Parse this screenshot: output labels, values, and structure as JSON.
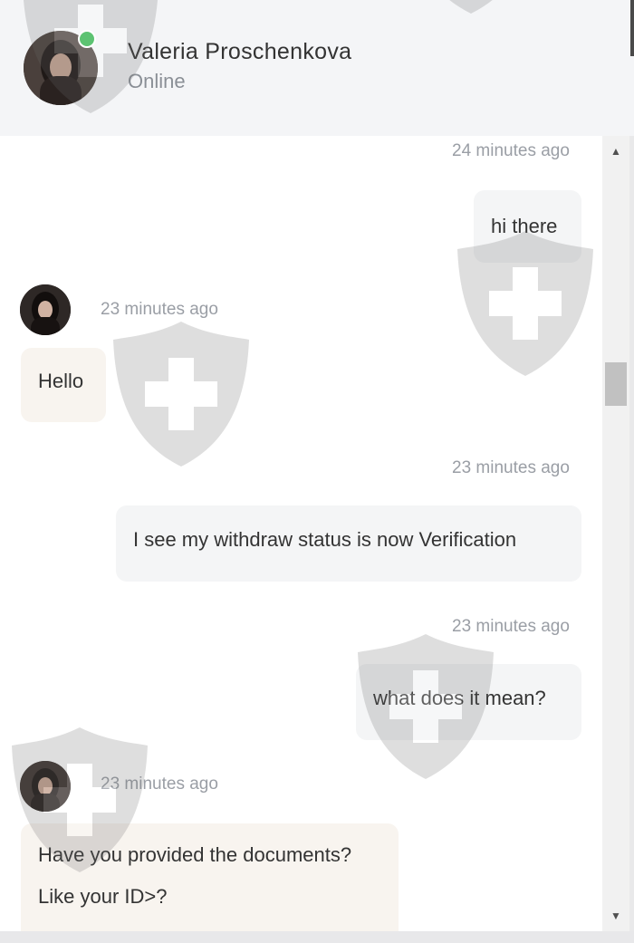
{
  "header": {
    "name": "Valeria Proschenkova",
    "status": "Online"
  },
  "messages": [
    {
      "direction": "out",
      "time": "24 minutes ago",
      "text": "hi there"
    },
    {
      "direction": "in",
      "time": "23 minutes ago",
      "text": "Hello"
    },
    {
      "direction": "out",
      "time": "23 minutes ago",
      "text": "I see my withdraw status is now Verification"
    },
    {
      "direction": "out",
      "time": "23 minutes ago",
      "text": "what does it mean?"
    },
    {
      "direction": "in",
      "time": "23 minutes ago",
      "lines": [
        "Have you provided the documents?",
        "Like your ID>?"
      ]
    }
  ],
  "icons": {
    "scroll_up": "triangle-up",
    "scroll_down": "triangle-down",
    "watermark": "shield-cross"
  },
  "colors": {
    "online": "#2fb34a",
    "outgoing_bubble": "#f4f5f6",
    "incoming_bubble": "#f8f4ef",
    "header_bg": "#f4f5f7"
  }
}
